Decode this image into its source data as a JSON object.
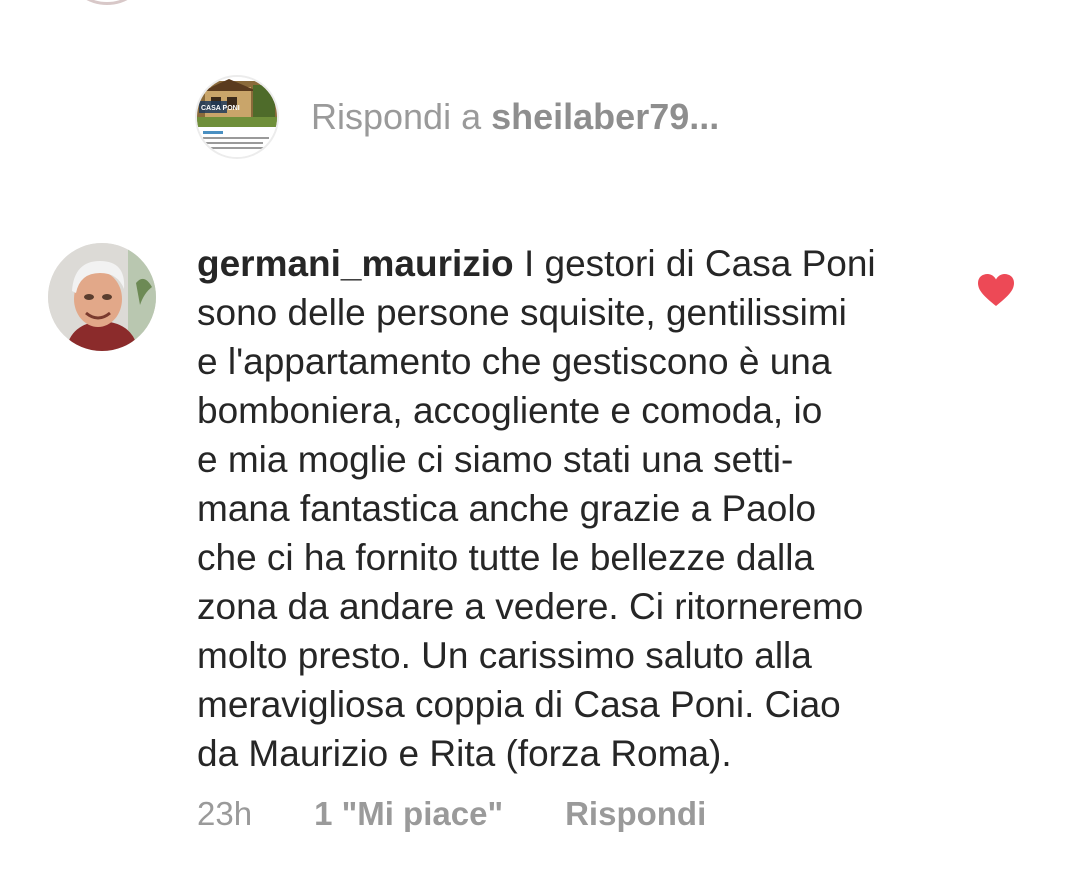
{
  "reply_prompt": {
    "prefix": "Rispondi a",
    "handle": "sheilaber79...",
    "avatar": {
      "logo_line1": "CASA PONI"
    }
  },
  "comment": {
    "username": "germani_maurizio",
    "lines": [
      "I gestori di Casa Poni",
      "sono delle persone squisite, gentilissimi",
      "e l'appartamento che gestiscono è una",
      "bomboniera, accogliente e comoda, io",
      "e mia moglie ci siamo stati una setti-",
      "mana fantastica anche grazie a Paolo",
      "che ci ha fornito tutte le bellezze dalla",
      "zona da andare a vedere. Ci ritorneremo",
      "molto presto. Un carissimo saluto alla",
      "meravigliosa coppia di Casa Poni. Ciao",
      "da Maurizio e Rita (forza Roma)."
    ],
    "liked": true,
    "heart_color": "#ed4956",
    "time": "23h",
    "likes_label": "1 \"Mi piace\"",
    "reply_label": "Rispondi"
  }
}
